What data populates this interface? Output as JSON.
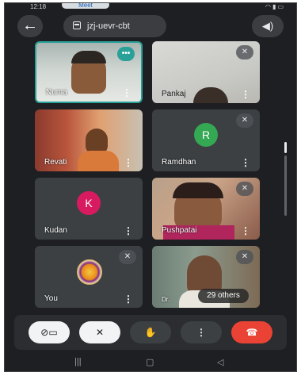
{
  "status_bar": {
    "clock": "12:18",
    "pill": "Meet"
  },
  "meeting": {
    "code": "jzj-uevr-cbt"
  },
  "tiles": [
    {
      "name": "Numa"
    },
    {
      "name": "Pankaj"
    },
    {
      "name": "Revati"
    },
    {
      "name": "Ramdhan",
      "initial": "R"
    },
    {
      "name": "Kudan",
      "initial": "K"
    },
    {
      "name": "Pushpatai"
    },
    {
      "name": "You"
    },
    {
      "name": "Dr."
    }
  ],
  "overflow": {
    "others": "29 others"
  },
  "colors": {
    "background": "#1e1f22",
    "tile": "#3c4043",
    "ramdhan_avatar": "#34a853",
    "kudan_avatar": "#d81b60",
    "end_call": "#ea4335",
    "speaking": "#2aa198"
  },
  "icons": {
    "back": "arrow-left-icon",
    "calendar": "calendar-icon",
    "audio": "speaker-icon",
    "camera_off": "camera-off-icon",
    "mic_off": "mic-off-icon",
    "raise_hand": "hand-icon",
    "more": "more-vertical-icon",
    "end_call": "phone-hangup-icon"
  }
}
